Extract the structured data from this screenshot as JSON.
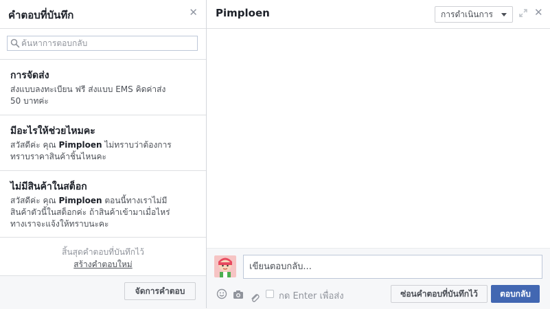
{
  "saved_replies_panel": {
    "title": "คำตอบที่บันทึก",
    "close_icon": "close-icon",
    "search": {
      "placeholder": "ค้นหาการตอบกลับ",
      "value": ""
    },
    "items": [
      {
        "title": "การจัดส่ง",
        "line1": "ส่งแบบลงทะเบียน ฟรี ส่งแบบ EMS คิดค่าส่ง",
        "line2": "50 บาทค่ะ"
      },
      {
        "title": "มีอะไรให้ช่วยไหมคะ",
        "line1_pre": "สวัสดีค่ะ คุณ ",
        "line1_name": "Pimploen",
        "line1_post": " ไม่ทราบว่าต้องการ",
        "line2": "ทราบราคาสินค้าชิ้นไหนคะ"
      },
      {
        "title": "ไม่มีสินค้าในสต็อก",
        "line1_pre": "สวัสดีค่ะ คุณ ",
        "line1_name": "Pimploen",
        "line1_post": " ตอนนี้ทางเราไม่มี",
        "line2": "สินค้าตัวนี้ในสต็อกค่ะ ถ้าสินค้าเข้ามาเมื่อไหร่",
        "line3": "ทางเราจะแจ้งให้ทราบนะคะ"
      }
    ],
    "end_note": "สิ้นสุดคำตอบที่บันทึกไว้",
    "create_link": "สร้างคำตอบใหม่",
    "manage_button": "จัดการคำตอบ"
  },
  "conversation": {
    "title": "Pimploen",
    "actions_button": "การดำเนินการ",
    "compose_placeholder": "เขียนตอบกลับ...",
    "enter_to_send_label": "กด Enter เพื่อส่ง",
    "enter_to_send_checked": false,
    "hide_saved_button": "ซ่อนคำตอบที่บันทึกไว้",
    "reply_button": "ตอบกลับ",
    "icons": [
      "expand-icon",
      "close-icon",
      "emoji-icon",
      "camera-icon",
      "attachment-icon"
    ]
  },
  "colors": {
    "primary": "#4267b2",
    "border": "#dddfe2",
    "footer_bg": "#f6f7f9",
    "muted_text": "#90949c"
  }
}
